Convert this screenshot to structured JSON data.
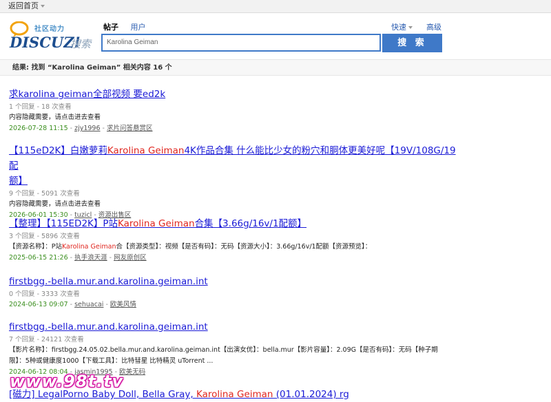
{
  "topbar": {
    "back_label": "返回首页"
  },
  "logo": {
    "subtitle": "社区动力",
    "brand": "DISCUZ!",
    "brand_sub": "搜索"
  },
  "tabs": [
    {
      "label": "帖子"
    },
    {
      "label": "用户"
    }
  ],
  "quick": {
    "label": "快速"
  },
  "advanced": {
    "label": "高级"
  },
  "search": {
    "value": "Karolina Geiman",
    "button_label": "搜 索"
  },
  "summary": {
    "text": "结果: 找到 “Karolina Geiman” 相关内容 16 个"
  },
  "results": [
    {
      "title_parts": [
        "求karolina geiman全部视频 要ed2k"
      ],
      "stats": "1 个回复 - 18 次查看",
      "excerpt_parts": [
        "内容隐藏需要，请点击进去查看"
      ],
      "date": "2026-07-28 11:15",
      "author": "zjy1996",
      "forum": "求片问答悬赏区"
    },
    {
      "title_parts": [
        "【115eD2K】白嫩萝莉",
        "Karolina Geiman",
        "4K作品合集 什么能比少女的粉穴和胴体更美好呢【19V/108G/19配"
      ],
      "title_line2": "额】",
      "stats": "9 个回复 - 5091 次查看",
      "excerpt_parts": [
        "内容隐藏需要，请点击进去查看"
      ],
      "date": "2026-06-01 15:30",
      "author": "tuzicl",
      "forum": "资源出售区"
    },
    {
      "title_parts": [
        "【整理】【115ED2K】P站",
        "Karolina Geiman",
        "合集【3.66g/16v/1配额】"
      ],
      "stats": "3 个回复 - 5896 次查看",
      "excerpt_parts": [
        "【资源名称】：P站",
        "Karolina Geiman",
        "合【资源类型】：视频【是否有码】：无码【资源大小】：3.66g/16v/1配额【资源预览】："
      ],
      "date": "2025-06-15 21:26",
      "author": "执手浪天涯",
      "forum": "网友原创区"
    },
    {
      "title_parts": [
        "firstbgg.-bella.mur.and.karolina.geiman.int"
      ],
      "stats": "0 个回复 - 3333 次查看",
      "date": "2024-06-13 09:07",
      "author": "sehuacai",
      "forum": "欧美风情"
    },
    {
      "title_parts": [
        "firstbgg.-bella.mur.and.karolina.geiman.int"
      ],
      "stats": "7 个回复 - 24121 次查看",
      "excerpt_parts": [
        "【影片名称】：firstbgg.24.05.02.bella.mur.and.karolina.geiman.int【出演女优】：bella.mur【影片容量】：2.09G【是否有码】：无码【种子期"
      ],
      "excerpt_line2": "限】：5种或健康度1000【下载工具】：比特彗星 比特精灵 uTorrent ...",
      "date": "2024-06-12 08:04",
      "author": "jasmin1995",
      "forum": "欧美无码"
    },
    {
      "title_parts": [
        "[磁力] LegalPorno Baby Doll, Bella Gray, ",
        "Karolina Geiman",
        " (01.01.2024) rg"
      ]
    }
  ],
  "watermark": {
    "text": "www.98t.tv"
  },
  "colors": {
    "accent": "#3f79c8",
    "link": "#1a1ad6",
    "highlight": "#e0261f",
    "date": "#3a8e1e"
  }
}
